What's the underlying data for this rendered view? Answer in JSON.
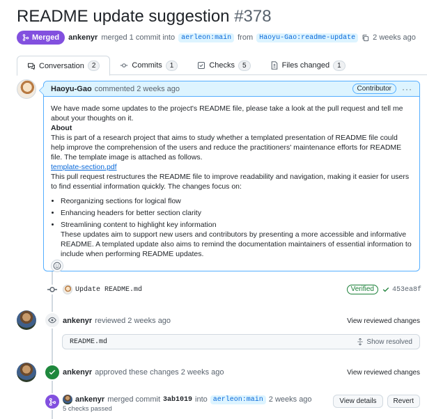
{
  "pr": {
    "title": "README update suggestion",
    "number": "#378",
    "status": "Merged",
    "merger": "ankenyr",
    "merge_text": "merged 1 commit into",
    "base_branch": "aerleon:main",
    "from_text": "from",
    "head_branch": "Haoyu-Gao:readme-update",
    "time": "2 weeks ago"
  },
  "tabs": [
    {
      "label": "Conversation",
      "count": "2"
    },
    {
      "label": "Commits",
      "count": "1"
    },
    {
      "label": "Checks",
      "count": "5"
    },
    {
      "label": "Files changed",
      "count": "1"
    }
  ],
  "comment": {
    "author": "Haoyu-Gao",
    "action": "commented 2 weeks ago",
    "role": "Contributor",
    "intro": "We have made some updates to the project's README file, please take a look at the pull request and tell me about your thoughts on it.",
    "about_heading": "About",
    "about_text": "This is part of a research project that aims to study whether a templated presentation of README file could help improve the comprehension of the users and reduce the practitioners' maintenance efforts for README file. The template image is attached as follows.",
    "link": "template-section.pdf",
    "summary": "This pull request restructures the README file to improve readability and navigation, making it easier for users to find essential information quickly. The changes focus on:",
    "bullets": [
      "Reorganizing sections for logical flow",
      "Enhancing headers for better section clarity",
      "Streamlining content to highlight key information"
    ],
    "closing": "These updates aim to support new users and contributors by presenting a more accessible and informative README. A templated update also aims to remind the documentation maintainers of essential information to include when performing README updates."
  },
  "commit": {
    "message": "Update README.md",
    "verified": "Verified",
    "sha": "453ea8f"
  },
  "review": {
    "author": "ankenyr",
    "action": "reviewed 2 weeks ago",
    "link": "View reviewed changes",
    "file": "README.md",
    "show_resolved": "Show resolved"
  },
  "approval": {
    "author": "ankenyr",
    "action": "approved these changes 2 weeks ago",
    "link": "View reviewed changes"
  },
  "merge": {
    "author": "ankenyr",
    "action_pre": "merged commit",
    "commit": "3ab1019",
    "into": "into",
    "branch": "aerleon:main",
    "time": "2 weeks ago",
    "checks": "5 checks passed",
    "details_button": "View details",
    "revert_button": "Revert"
  },
  "colors": {
    "merged_purple": "#8250df",
    "link_blue": "#0969da",
    "success_green": "#1a7f37",
    "comment_header": "#ddf4ff"
  }
}
